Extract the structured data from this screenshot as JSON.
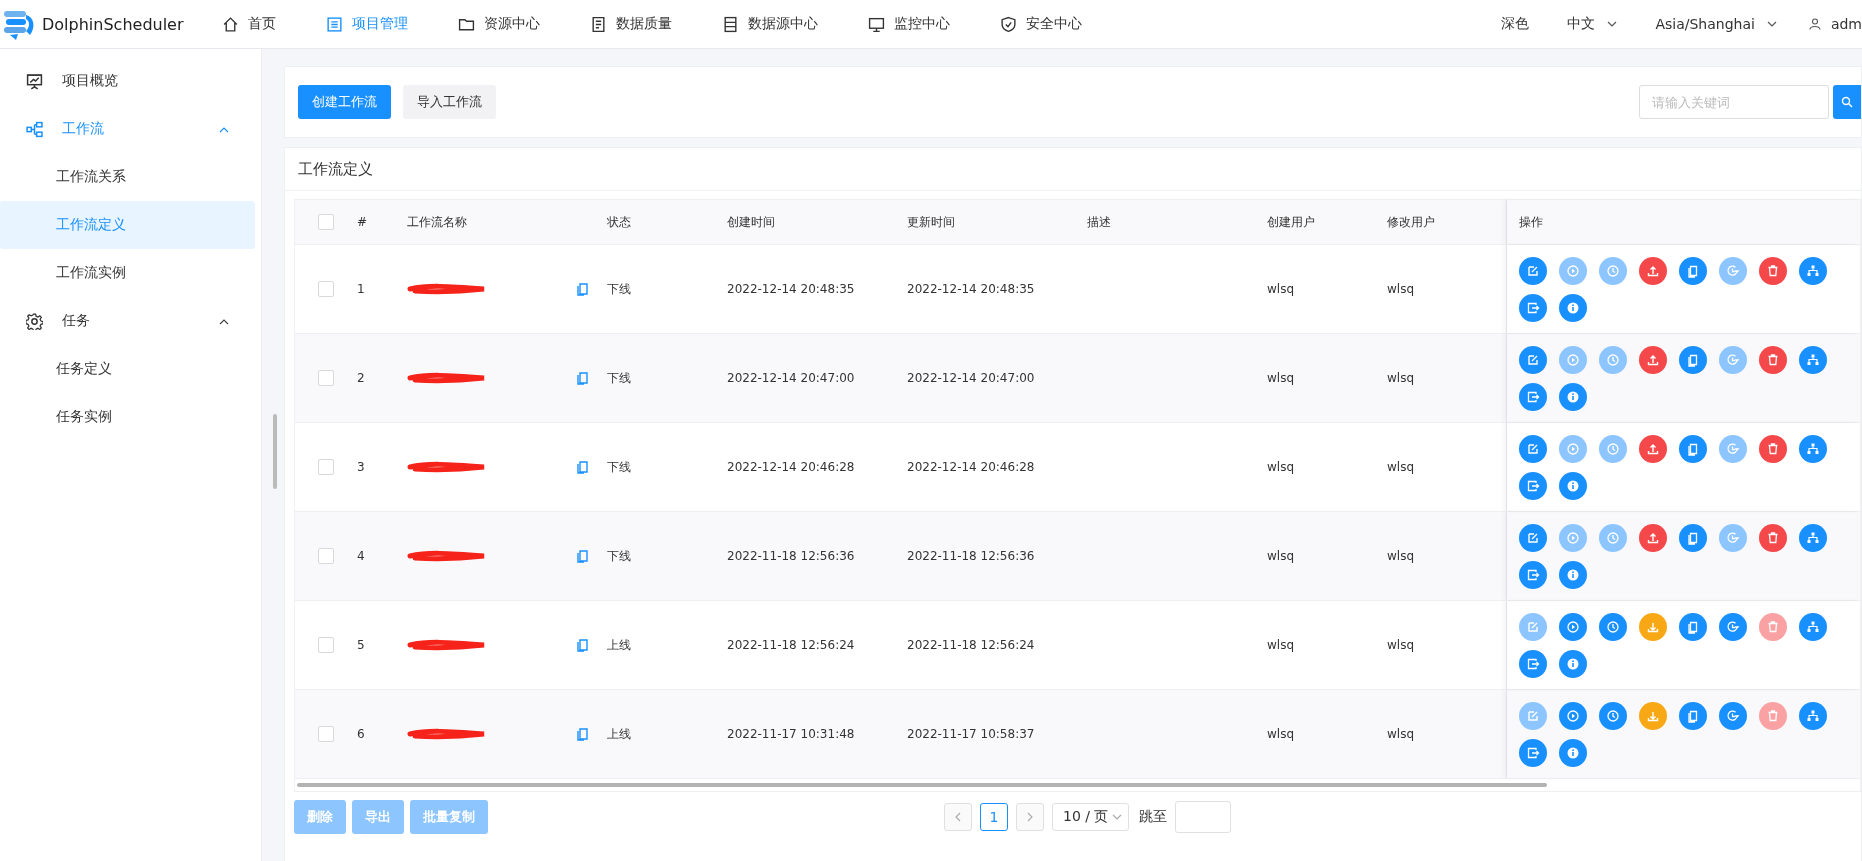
{
  "app": {
    "logo_text": "DolphinScheduler"
  },
  "nav": [
    {
      "label": "首页",
      "kind": "home",
      "selected": false
    },
    {
      "label": "项目管理",
      "kind": "project",
      "selected": true
    },
    {
      "label": "资源中心",
      "kind": "folder",
      "selected": false
    },
    {
      "label": "数据质量",
      "kind": "doc",
      "selected": false
    },
    {
      "label": "数据源中心",
      "kind": "server",
      "selected": false
    },
    {
      "label": "监控中心",
      "kind": "monitor",
      "selected": false
    },
    {
      "label": "安全中心",
      "kind": "shield",
      "selected": false
    }
  ],
  "header_right": {
    "theme": "深色",
    "language": "中文",
    "timezone": "Asia/Shanghai",
    "user": "adm"
  },
  "sidebar": {
    "items": [
      {
        "label": "项目概览",
        "kind": "overview",
        "selected": false
      },
      {
        "label": "工作流",
        "kind": "workflow",
        "selected": true,
        "expanded": true,
        "children": [
          {
            "label": "工作流关系",
            "selected": false
          },
          {
            "label": "工作流定义",
            "selected": true
          },
          {
            "label": "工作流实例",
            "selected": false
          }
        ]
      },
      {
        "label": "任务",
        "kind": "gear",
        "selected": false,
        "expanded": true,
        "children": [
          {
            "label": "任务定义",
            "selected": false
          },
          {
            "label": "任务实例",
            "selected": false
          }
        ]
      }
    ]
  },
  "toolbar": {
    "buttons": [
      {
        "label": "创建工作流",
        "kind": "primary"
      },
      {
        "label": "导入工作流",
        "kind": "default"
      }
    ],
    "search": {
      "placeholder": "请输入关键词"
    }
  },
  "panel": {
    "title": "工作流定义"
  },
  "table": {
    "header_checked": false,
    "columns": [
      "#",
      "工作流名称",
      "状态",
      "创建时间",
      "更新时间",
      "描述",
      "创建用户",
      "修改用户",
      "操作"
    ],
    "rows": [
      {
        "checked": false,
        "index": "1",
        "status": "下线",
        "created": "2022-12-14 20:48:35",
        "updated": "2022-12-14 20:48:35",
        "creator": "wlsq",
        "modifier": "wlsq",
        "actions": [
          {
            "kind": "edit",
            "disabled": false
          },
          {
            "kind": "run",
            "disabled": true
          },
          {
            "kind": "timing",
            "disabled": true
          },
          {
            "kind": "online",
            "disabled": false
          },
          {
            "kind": "copy",
            "disabled": false
          },
          {
            "kind": "versions",
            "disabled": true
          },
          {
            "kind": "delete",
            "disabled": false
          },
          {
            "kind": "tree",
            "disabled": false
          },
          {
            "kind": "export",
            "disabled": false
          },
          {
            "kind": "info",
            "disabled": false
          }
        ]
      },
      {
        "checked": false,
        "index": "2",
        "status": "下线",
        "created": "2022-12-14 20:47:00",
        "updated": "2022-12-14 20:47:00",
        "creator": "wlsq",
        "modifier": "wlsq",
        "actions": [
          {
            "kind": "edit",
            "disabled": false
          },
          {
            "kind": "run",
            "disabled": true
          },
          {
            "kind": "timing",
            "disabled": true
          },
          {
            "kind": "online",
            "disabled": false
          },
          {
            "kind": "copy",
            "disabled": false
          },
          {
            "kind": "versions",
            "disabled": true
          },
          {
            "kind": "delete",
            "disabled": false
          },
          {
            "kind": "tree",
            "disabled": false
          },
          {
            "kind": "export",
            "disabled": false
          },
          {
            "kind": "info",
            "disabled": false
          }
        ]
      },
      {
        "checked": false,
        "index": "3",
        "status": "下线",
        "created": "2022-12-14 20:46:28",
        "updated": "2022-12-14 20:46:28",
        "creator": "wlsq",
        "modifier": "wlsq",
        "actions": [
          {
            "kind": "edit",
            "disabled": false
          },
          {
            "kind": "run",
            "disabled": true
          },
          {
            "kind": "timing",
            "disabled": true
          },
          {
            "kind": "online",
            "disabled": false
          },
          {
            "kind": "copy",
            "disabled": false
          },
          {
            "kind": "versions",
            "disabled": true
          },
          {
            "kind": "delete",
            "disabled": false
          },
          {
            "kind": "tree",
            "disabled": false
          },
          {
            "kind": "export",
            "disabled": false
          },
          {
            "kind": "info",
            "disabled": false
          }
        ]
      },
      {
        "checked": false,
        "index": "4",
        "status": "下线",
        "created": "2022-11-18 12:56:36",
        "updated": "2022-11-18 12:56:36",
        "creator": "wlsq",
        "modifier": "wlsq",
        "actions": [
          {
            "kind": "edit",
            "disabled": false
          },
          {
            "kind": "run",
            "disabled": true
          },
          {
            "kind": "timing",
            "disabled": true
          },
          {
            "kind": "online",
            "disabled": false
          },
          {
            "kind": "copy",
            "disabled": false
          },
          {
            "kind": "versions",
            "disabled": true
          },
          {
            "kind": "delete",
            "disabled": false
          },
          {
            "kind": "tree",
            "disabled": false
          },
          {
            "kind": "export",
            "disabled": false
          },
          {
            "kind": "info",
            "disabled": false
          }
        ]
      },
      {
        "checked": false,
        "index": "5",
        "status": "上线",
        "created": "2022-11-18 12:56:24",
        "updated": "2022-11-18 12:56:24",
        "creator": "wlsq",
        "modifier": "wlsq",
        "actions": [
          {
            "kind": "edit",
            "disabled": true
          },
          {
            "kind": "run",
            "disabled": false
          },
          {
            "kind": "timing",
            "disabled": false
          },
          {
            "kind": "offline",
            "disabled": false
          },
          {
            "kind": "copy",
            "disabled": false
          },
          {
            "kind": "versions",
            "disabled": false
          },
          {
            "kind": "delete",
            "disabled": true
          },
          {
            "kind": "tree",
            "disabled": false
          },
          {
            "kind": "export",
            "disabled": false
          },
          {
            "kind": "info",
            "disabled": false
          }
        ]
      },
      {
        "checked": false,
        "index": "6",
        "status": "上线",
        "created": "2022-11-17 10:31:48",
        "updated": "2022-11-17 10:58:37",
        "creator": "wlsq",
        "modifier": "wlsq",
        "actions": [
          {
            "kind": "edit",
            "disabled": true
          },
          {
            "kind": "run",
            "disabled": false
          },
          {
            "kind": "timing",
            "disabled": false
          },
          {
            "kind": "offline",
            "disabled": false
          },
          {
            "kind": "copy",
            "disabled": false
          },
          {
            "kind": "versions",
            "disabled": false
          },
          {
            "kind": "delete",
            "disabled": true
          },
          {
            "kind": "tree",
            "disabled": false
          },
          {
            "kind": "export",
            "disabled": false
          },
          {
            "kind": "info",
            "disabled": false
          }
        ]
      }
    ]
  },
  "batch_buttons": [
    {
      "label": "删除",
      "disabled": true
    },
    {
      "label": "导出",
      "disabled": true
    },
    {
      "label": "批量复制",
      "disabled": true
    }
  ],
  "pagination": {
    "pages": [
      {
        "label": "1",
        "selected": true
      }
    ],
    "page_size": "10 / 页",
    "jump_label": "跳至"
  }
}
